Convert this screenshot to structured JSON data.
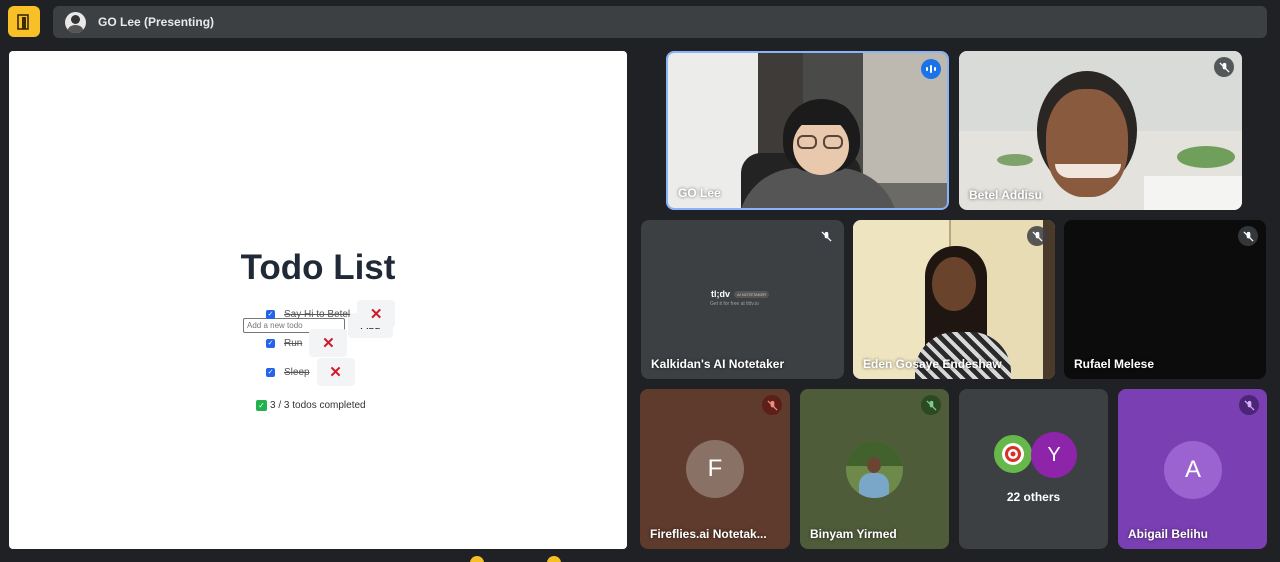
{
  "topbar": {
    "presenting_label": "GO Lee (Presenting)"
  },
  "todo": {
    "title": "Todo List",
    "input_placeholder": "Add a new todo",
    "add_label": "Add",
    "items": [
      {
        "text": "Say Hi to Betel",
        "completed": true
      },
      {
        "text": "Run",
        "completed": true
      },
      {
        "text": "Sleep",
        "completed": true
      }
    ],
    "summary": "3 / 3 todos completed"
  },
  "participants": [
    {
      "name": "GO Lee",
      "state": "speaking"
    },
    {
      "name": "Betel Addisu",
      "state": "muted"
    },
    {
      "name": "Kalkidan's AI Notetaker",
      "state": "muted"
    },
    {
      "name": "Eden Gosaye Endeshaw",
      "state": "muted"
    },
    {
      "name": "Rufael Melese",
      "state": "muted"
    },
    {
      "name": "Fireflies.ai Notetak...",
      "state": "muted",
      "initial": "F"
    },
    {
      "name": "Binyam Yirmed",
      "state": "muted"
    },
    {
      "name": "Abigail Belihu",
      "state": "muted",
      "initial": "A"
    }
  ],
  "others_tile": {
    "label": "22 others",
    "initial": "Y"
  },
  "notetaker_card": {
    "logo": "tl;dv",
    "badge": "AI NOTETAKER",
    "tagline": "Get it for free at tldv.io"
  },
  "colors": {
    "accent": "#8ab4f8",
    "app_icon": "#f6c026",
    "speaking_indicator": "#1a73e8"
  }
}
